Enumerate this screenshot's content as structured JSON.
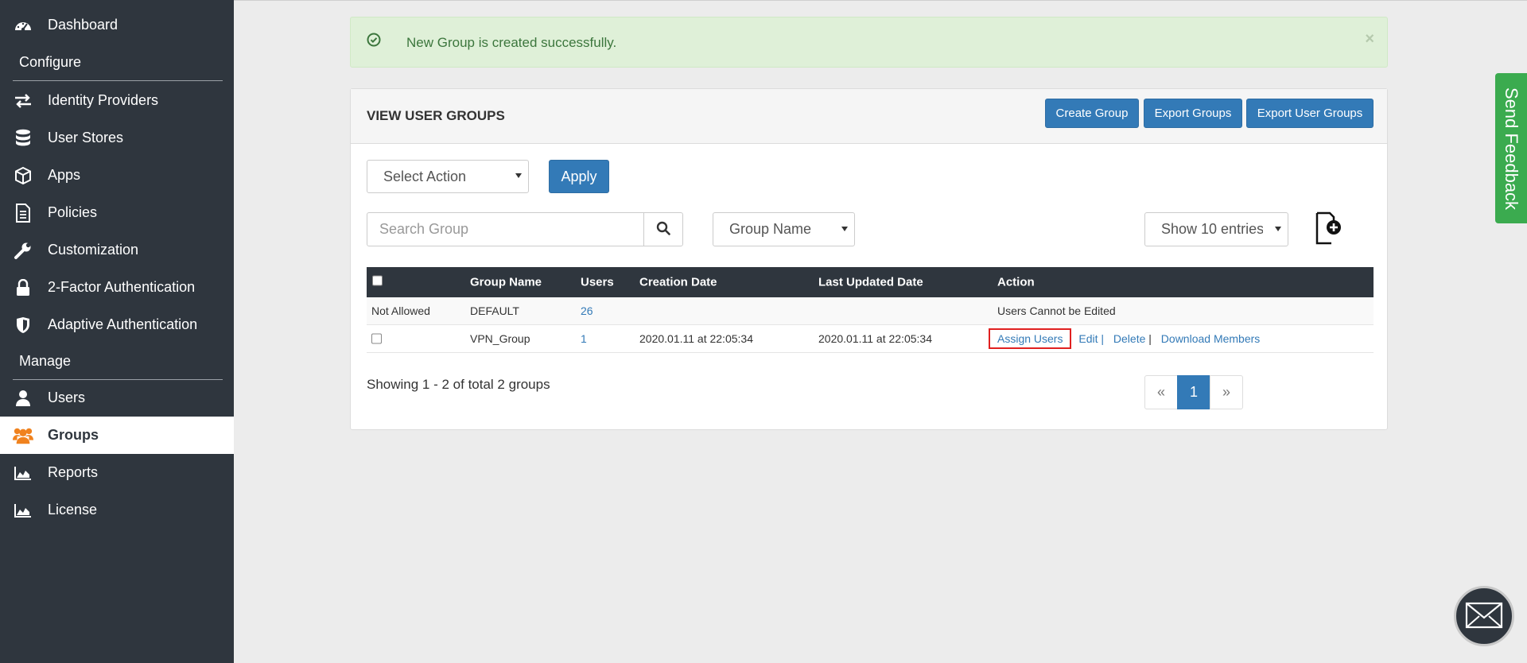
{
  "sidebar": {
    "items": [
      {
        "label": "Dashboard",
        "icon": "dashboard-icon"
      },
      {
        "label": "Identity Providers",
        "icon": "arrows-exchange-icon"
      },
      {
        "label": "User Stores",
        "icon": "database-icon"
      },
      {
        "label": "Apps",
        "icon": "cube-icon"
      },
      {
        "label": "Policies",
        "icon": "document-icon"
      },
      {
        "label": "Customization",
        "icon": "wrench-icon"
      },
      {
        "label": "2-Factor Authentication",
        "icon": "lock-icon"
      },
      {
        "label": "Adaptive Authentication",
        "icon": "shield-icon"
      },
      {
        "label": "Users",
        "icon": "user-icon"
      },
      {
        "label": "Groups",
        "icon": "users-group-icon"
      },
      {
        "label": "Reports",
        "icon": "area-chart-icon"
      },
      {
        "label": "License",
        "icon": "area-chart-icon"
      }
    ],
    "section_configure": "Configure",
    "section_manage": "Manage",
    "active": "Groups"
  },
  "alert": {
    "message": "New Group is created successfully.",
    "close": "×"
  },
  "panel": {
    "title": "VIEW USER GROUPS",
    "buttons": {
      "create": "Create Group",
      "export_groups": "Export Groups",
      "export_user_groups": "Export User Groups"
    },
    "select_action": "Select Action",
    "apply": "Apply",
    "search_placeholder": "Search Group",
    "filter_field": "Group Name",
    "entries": "Show 10 entries"
  },
  "table": {
    "headers": {
      "group_name": "Group Name",
      "users": "Users",
      "creation_date": "Creation Date",
      "last_updated": "Last Updated Date",
      "action": "Action"
    },
    "rows": [
      {
        "select": "Not Allowed",
        "group_name": "DEFAULT",
        "users": "26",
        "creation_date": "",
        "last_updated": "",
        "action": "Users Cannot be Edited"
      },
      {
        "group_name": "VPN_Group",
        "users": "1",
        "creation_date": "2020.01.11 at 22:05:34",
        "last_updated": "2020.01.11 at 22:05:34",
        "actions": {
          "assign": "Assign Users",
          "edit": "Edit",
          "sep1": "|",
          "delete": "Delete",
          "sep2": "|",
          "download": "Download Members"
        }
      }
    ]
  },
  "footer": {
    "showing": "Showing 1 - 2 of total 2 groups"
  },
  "pagination": {
    "prev": "«",
    "current": "1",
    "next": "»"
  },
  "feedback": {
    "label": "Send Feedback"
  },
  "colors": {
    "sidebar": "#2f363e",
    "primary": "#337ab7",
    "success_bg": "#dff0d8",
    "success_text": "#3c763d",
    "feedback": "#3bab4f",
    "groups_icon": "#f0821e"
  }
}
